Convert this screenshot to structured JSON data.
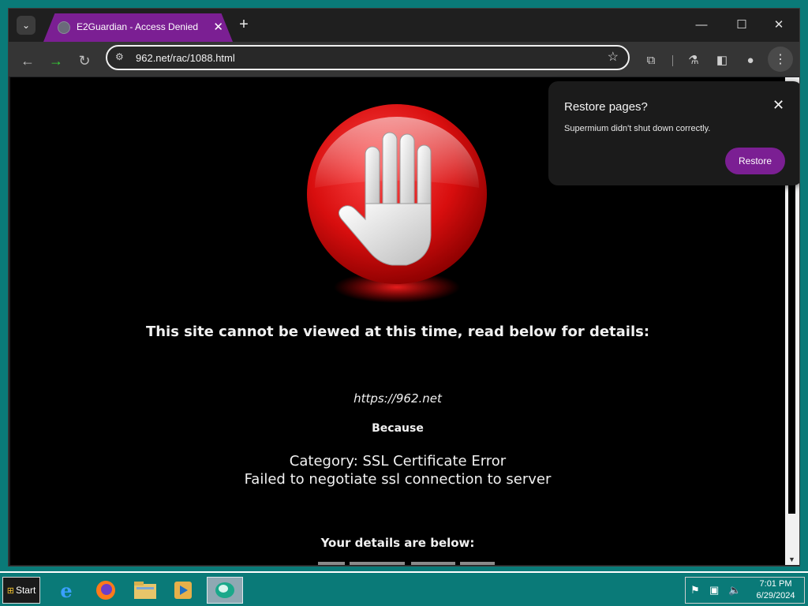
{
  "browser": {
    "tab_title": "E2Guardian - Access Denied",
    "address": "962.net/rac/1088.html",
    "icons": [
      "tab-search-icon",
      "favicon-icon",
      "close-icon",
      "plus-icon",
      "minimize-icon",
      "maximize-icon",
      "back-icon",
      "forward-icon",
      "reload-icon",
      "site-info-icon",
      "star-icon",
      "extensions-icon",
      "labs-icon",
      "side-panel-icon",
      "profile-icon",
      "menu-icon"
    ]
  },
  "popup": {
    "title": "Restore pages?",
    "message": "Supermium didn't shut down correctly.",
    "button": "Restore"
  },
  "page": {
    "headline": "This site cannot be viewed at this time, read below for details:",
    "blocked_url": "https://962.net",
    "because": "Because",
    "category": "Category: SSL Certificate Error",
    "reason": "Failed to negotiate ssl connection to server",
    "details_heading": "Your details are below:"
  },
  "taskbar": {
    "start_label": "Start",
    "time": "7:01 PM",
    "date": "6/29/2024"
  },
  "colors": {
    "tab_accent": "#7b1f93",
    "page_background": "#000000",
    "desktop": "#0a7a78"
  }
}
